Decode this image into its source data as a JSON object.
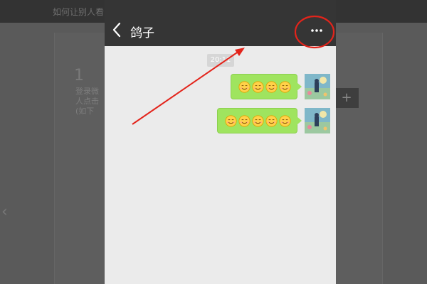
{
  "background_page": {
    "title": "如何让别人看",
    "step_number": "1",
    "step_lines": [
      "登录微",
      "人点击",
      "(如下"
    ],
    "prev_arrow": "‹",
    "add_button": "+"
  },
  "chat": {
    "back_label": "<",
    "title": "鸽子",
    "more_label": "···",
    "timestamp": "20:11",
    "messages": [
      {
        "sender": "self",
        "emoji_count": 4,
        "emoji": "smile-face"
      },
      {
        "sender": "self",
        "emoji_count": 5,
        "emoji": "smile-face"
      }
    ]
  },
  "colors": {
    "header": "#353535",
    "chat_bg": "#ebebeb",
    "bubble": "#9fe45f",
    "annotation": "#ff0000"
  },
  "annotation": {
    "circle_target": "more-button",
    "arrow_target": "more-button"
  }
}
